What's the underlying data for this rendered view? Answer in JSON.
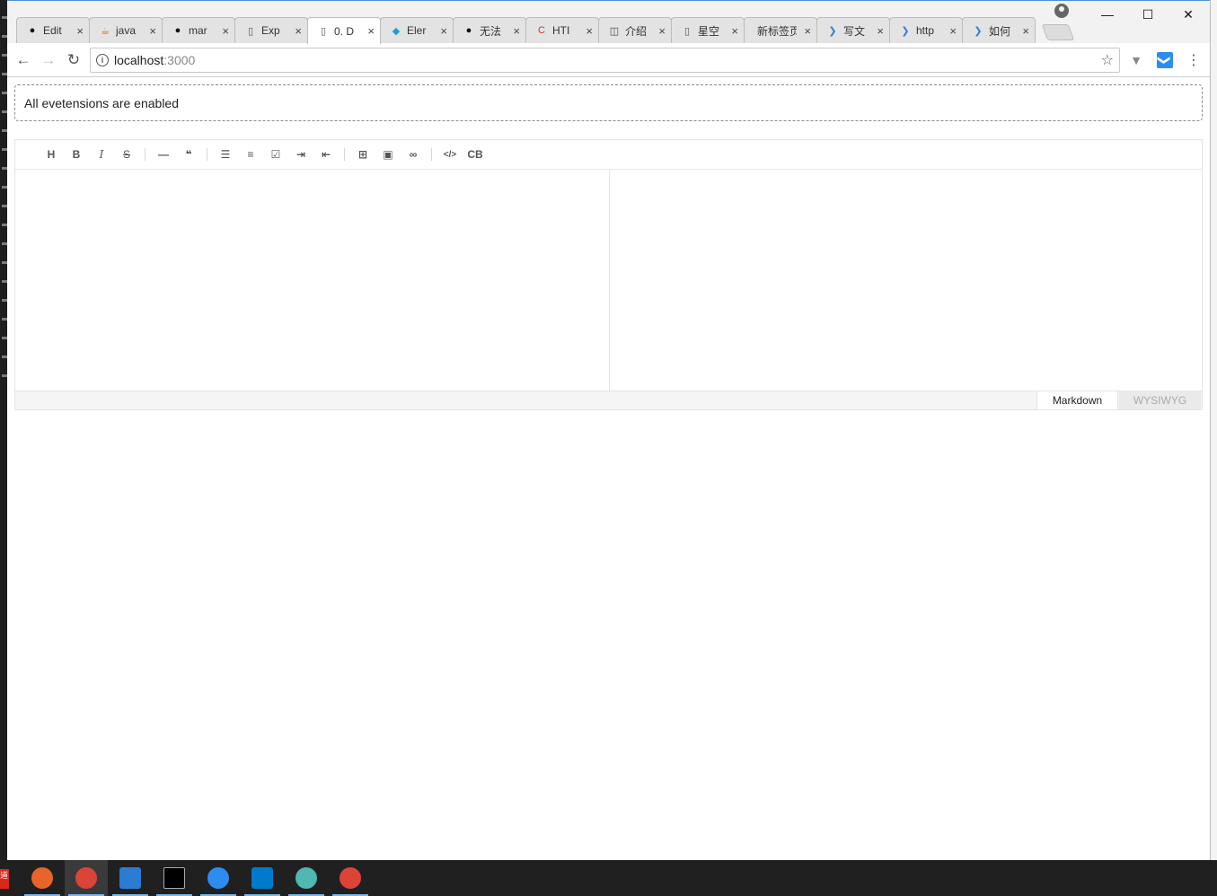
{
  "browser": {
    "tabs": [
      {
        "title": "Edit",
        "icon": "github-icon",
        "active": false
      },
      {
        "title": "java",
        "icon": "java-icon",
        "active": false
      },
      {
        "title": "mar",
        "icon": "github-icon",
        "active": false
      },
      {
        "title": "Exp",
        "icon": "page-icon",
        "active": false
      },
      {
        "title": "0. D",
        "icon": "page-icon",
        "active": true
      },
      {
        "title": "Eler",
        "icon": "element-icon",
        "active": false
      },
      {
        "title": "无法",
        "icon": "github-icon",
        "active": false
      },
      {
        "title": "HTI",
        "icon": "csdn-icon",
        "active": false
      },
      {
        "title": "介绍",
        "icon": "book-icon",
        "active": false
      },
      {
        "title": "星空",
        "icon": "page-icon",
        "active": false
      },
      {
        "title": "新标签页",
        "icon": "none",
        "active": false
      },
      {
        "title": "写文",
        "icon": "bookmark-icon",
        "active": false
      },
      {
        "title": "http",
        "icon": "bookmark-icon",
        "active": false
      },
      {
        "title": "如何",
        "icon": "bookmark-icon",
        "active": false
      }
    ],
    "tab_close_glyph": "×",
    "window_controls": {
      "minimize": "—",
      "maximize": "☐",
      "close": "✕"
    },
    "nav": {
      "back": "←",
      "forward": "→",
      "reload": "↻"
    },
    "address": {
      "host": "localhost",
      "port": ":3000",
      "info_glyph": "i",
      "star_glyph": "☆"
    },
    "extensions": [
      {
        "name": "vue-devtools-icon",
        "glyph": "▼"
      },
      {
        "name": "bookmark-ext-icon",
        "glyph": "❯"
      }
    ],
    "menu_glyph": "⋮"
  },
  "page": {
    "notice_text": "All evetensions are enabled",
    "editor": {
      "toolbar": [
        {
          "name": "heading-button",
          "label": "H",
          "style": "bold"
        },
        {
          "name": "bold-button",
          "label": "B",
          "style": "bold"
        },
        {
          "name": "italic-button",
          "label": "I",
          "style": "ital"
        },
        {
          "name": "strike-button",
          "label": "S",
          "style": "strike"
        },
        {
          "sep": true
        },
        {
          "name": "hr-button",
          "label": "—",
          "style": "bold"
        },
        {
          "name": "quote-button",
          "label": "❝",
          "style": "bold"
        },
        {
          "sep": true
        },
        {
          "name": "ul-button",
          "label": "☰",
          "style": "bold"
        },
        {
          "name": "ol-button",
          "label": "≡",
          "style": "bold"
        },
        {
          "name": "task-button",
          "label": "☑",
          "style": "bold"
        },
        {
          "name": "indent-button",
          "label": "⇥",
          "style": "bold"
        },
        {
          "name": "outdent-button",
          "label": "⇤",
          "style": "bold"
        },
        {
          "sep": true
        },
        {
          "name": "table-button",
          "label": "⊞",
          "style": "bold"
        },
        {
          "name": "image-button",
          "label": "▣",
          "style": "bold"
        },
        {
          "name": "link-button",
          "label": "∞",
          "style": "bold"
        },
        {
          "sep": true
        },
        {
          "name": "code-button",
          "label": "</>",
          "style": "bold"
        },
        {
          "name": "codeblock-button",
          "label": "CB",
          "style": "bold"
        }
      ],
      "modes": {
        "markdown": "Markdown",
        "wysiwyg": "WYSIWYG"
      }
    }
  },
  "taskbar": {
    "apps": [
      {
        "name": "firefox-icon",
        "color": "#e8642a",
        "active": false
      },
      {
        "name": "chrome-icon",
        "color": "#db4437",
        "active": true
      },
      {
        "name": "mail-icon",
        "color": "#2b7cd3",
        "active": false
      },
      {
        "name": "terminal-icon",
        "color": "#000000",
        "active": false
      },
      {
        "name": "feather-icon",
        "color": "#2d8cf0",
        "active": false
      },
      {
        "name": "vscode-icon",
        "color": "#007acc",
        "active": false
      },
      {
        "name": "fish-icon",
        "color": "#4fb8b0",
        "active": false
      },
      {
        "name": "chrome-icon-2",
        "color": "#db4437",
        "active": false
      }
    ],
    "start_label": "道"
  }
}
